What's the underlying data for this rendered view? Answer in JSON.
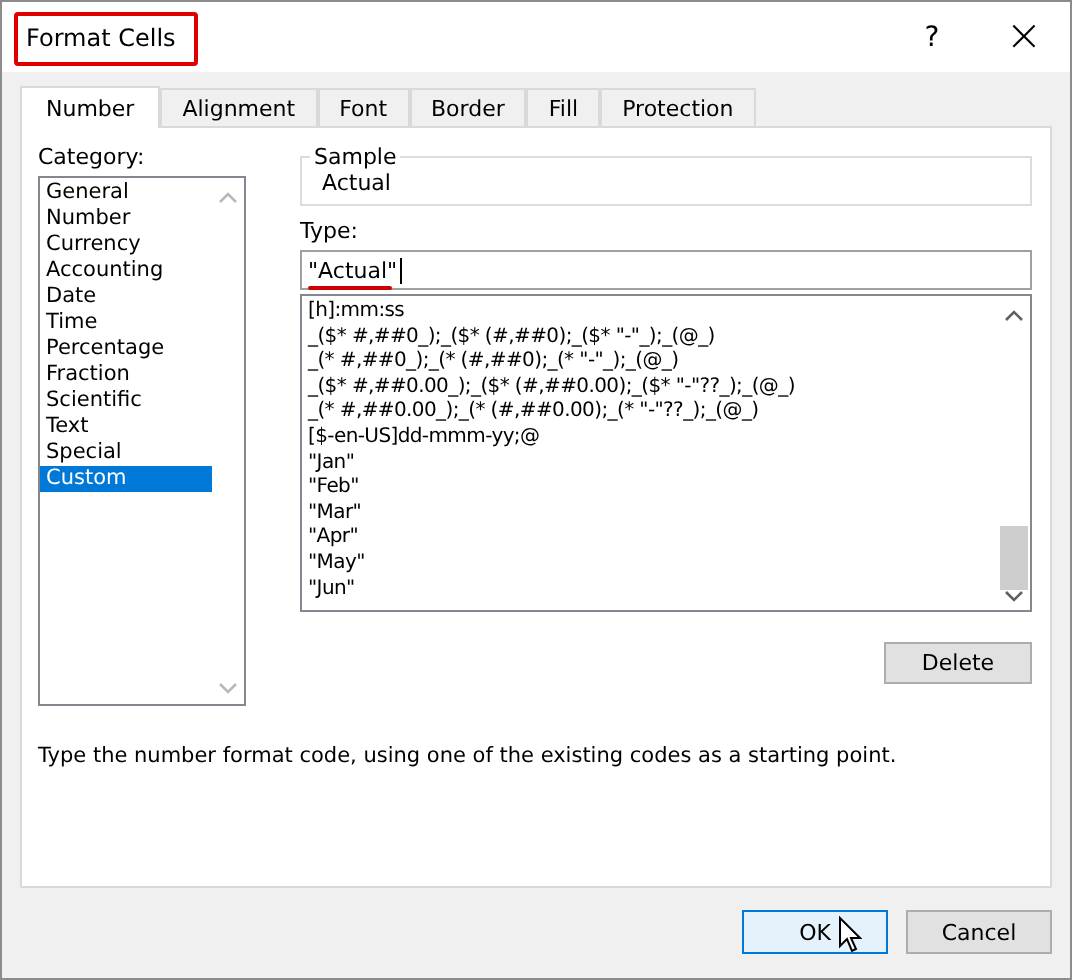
{
  "window": {
    "title": "Format Cells",
    "help": "?",
    "close": "×"
  },
  "tabs": [
    {
      "label": "Number",
      "selected": true
    },
    {
      "label": "Alignment",
      "selected": false
    },
    {
      "label": "Font",
      "selected": false
    },
    {
      "label": "Border",
      "selected": false
    },
    {
      "label": "Fill",
      "selected": false
    },
    {
      "label": "Protection",
      "selected": false
    }
  ],
  "category": {
    "label": "Category:",
    "items": [
      {
        "label": "General",
        "selected": false
      },
      {
        "label": "Number",
        "selected": false
      },
      {
        "label": "Currency",
        "selected": false
      },
      {
        "label": "Accounting",
        "selected": false
      },
      {
        "label": "Date",
        "selected": false
      },
      {
        "label": "Time",
        "selected": false
      },
      {
        "label": "Percentage",
        "selected": false
      },
      {
        "label": "Fraction",
        "selected": false
      },
      {
        "label": "Scientific",
        "selected": false
      },
      {
        "label": "Text",
        "selected": false
      },
      {
        "label": "Special",
        "selected": false
      },
      {
        "label": "Custom",
        "selected": true
      }
    ]
  },
  "sample": {
    "label": "Sample",
    "value": "Actual"
  },
  "type": {
    "label": "Type:",
    "value": "\"Actual\"",
    "codes": [
      "[h]:mm:ss",
      "_($* #,##0_);_($* (#,##0);_($* \"-\"_);_(@_)",
      "_(* #,##0_);_(* (#,##0);_(* \"-\"_);_(@_)",
      "_($* #,##0.00_);_($* (#,##0.00);_($* \"-\"??_);_(@_)",
      "_(* #,##0.00_);_(* (#,##0.00);_(* \"-\"??_);_(@_)",
      "[$-en-US]dd-mmm-yy;@",
      "\"Jan\"",
      "\"Feb\"",
      "\"Mar\"",
      "\"Apr\"",
      "\"May\"",
      "\"Jun\""
    ]
  },
  "delete_button": "Delete",
  "description": "Type the number format code, using one of the existing codes as a starting point.",
  "buttons": [
    {
      "label": "OK",
      "kind": "default"
    },
    {
      "label": "Cancel",
      "kind": "normal"
    }
  ]
}
